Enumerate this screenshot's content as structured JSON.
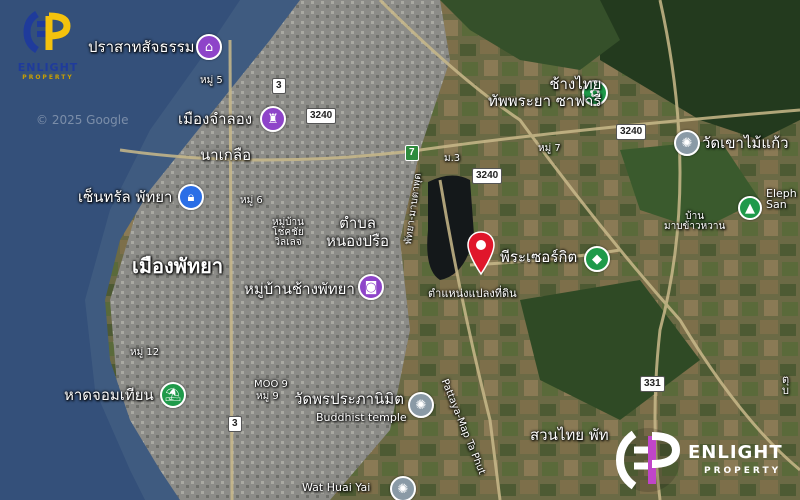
{
  "map": {
    "watermark": "© 2025 Google",
    "pin_label": "ตำแหน่งแปลงที่ดิน",
    "labels": {
      "city": "เมืองพัทยา",
      "prasat": "ปราสาทสัจธรรม",
      "moo5": "หมู่ 5",
      "mueang_jamlong": "เมืองจำลอง",
      "na_kluea": "นาเกลือ",
      "central": "เซ็นทรัล พัทยา",
      "moo6": "หมู่ 6",
      "village_skyline": "หมู่บ้าน\nโชคชัย\nวิลเลจ",
      "tambon": "ตำบล\nหนองปรือ",
      "elephant_village": "หมู่บ้านช้างพัทยา",
      "moo12": "หมู่ 12",
      "jomtien": "หาดจอมเทียน",
      "moo9": "MOO 9",
      "moo9_th": "หมู่ 9",
      "wat_phra": "วัดพรประภานิมิต",
      "buddhist": "Buddhist temple",
      "wat_huai_yai": "Wat Huai Yai",
      "moo3": "ม.3",
      "moo7": "หมู่ 7",
      "elephant_garden": "ช้างไทย\nทัพพระยา ซาฟารี",
      "wat_khao": "วัดเขาไม้แก้ว",
      "baan": "บ้าน\nมาบข้าวหวาน",
      "phra": "พีระเซอร์กิต",
      "road_name": "Pattaya-Map Ta Phut",
      "road_name_th": "พัทยา-มาบตาพุด",
      "suan_thai": "สวนไทย พัท",
      "eleph_san": "Eleph\nSan",
      "right_edge": "ตุ\nบ"
    },
    "shields": [
      "3",
      "3240",
      "7",
      "3240",
      "3240",
      "3",
      "331"
    ],
    "poi_icons": {
      "purple_1": "temple-icon",
      "purple_2": "attraction-icon",
      "purple_3": "camera-icon",
      "blue_1": "shopping-icon",
      "green_1": "beach-icon",
      "green_2": "paw-icon",
      "green_3": "park-icon",
      "grey_1": "temple-icon",
      "grey_2": "temple-icon",
      "grey_3": "temple-icon"
    }
  },
  "brand": {
    "name": "ENLIGHT",
    "sub": "PROPERTY"
  },
  "colors": {
    "sea": "#3f5b80",
    "urban": "#8c8c88",
    "pin": "#e0162b",
    "accent": "#f4c20d"
  }
}
